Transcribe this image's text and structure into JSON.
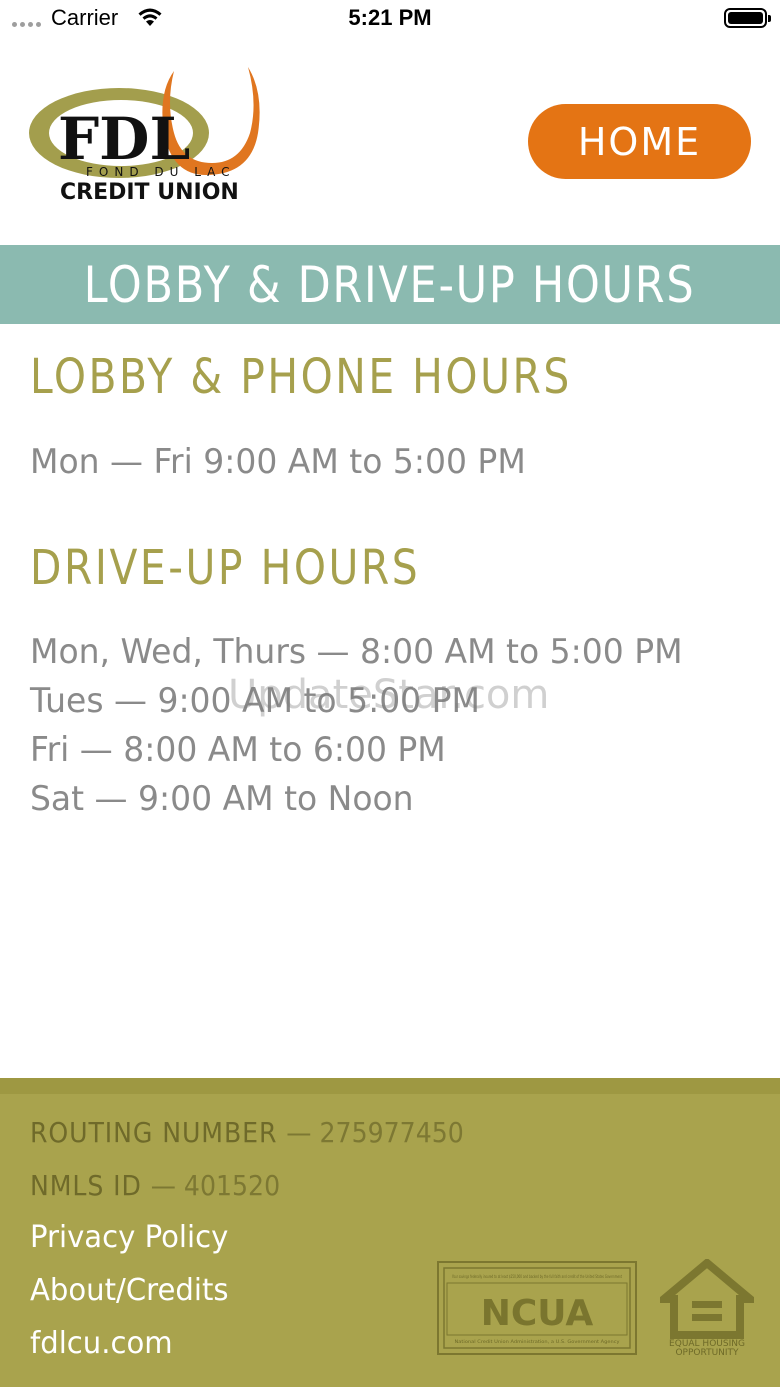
{
  "status_bar": {
    "carrier": "Carrier",
    "time": "5:21 PM"
  },
  "header": {
    "logo": {
      "brand": "FDL",
      "tagline": "FOND DU LAC",
      "subtitle": "CREDIT UNION",
      "colors": {
        "gold": "#a39e4d",
        "orange": "#e07620",
        "black": "#111111"
      }
    },
    "home_button": "HOME"
  },
  "title": "LOBBY & DRIVE-UP HOURS",
  "sections": {
    "lobby": {
      "heading": "LOBBY & PHONE HOURS",
      "lines": [
        "Mon — Fri 9:00 AM to 5:00 PM"
      ]
    },
    "drive_up": {
      "heading": "DRIVE-UP HOURS",
      "lines": [
        "Mon, Wed, Thurs — 8:00 AM to 5:00 PM",
        "Tues — 9:00 AM to 5:00 PM",
        "Fri — 8:00 AM to 6:00 PM",
        "Sat — 9:00 AM to Noon"
      ]
    }
  },
  "watermark": "UpdateStar.com",
  "footer": {
    "routing_label": "ROUTING NUMBER",
    "routing_value": "— 275977450",
    "nmls_label": "NMLS ID",
    "nmls_value": "— 401520",
    "links": [
      "Privacy Policy",
      "About/Credits",
      "fdlcu.com"
    ],
    "ncua_badge": {
      "name": "NCUA",
      "top_text": "Your savings federally insured to at least $250,000 and backed by the full faith and credit of the United States Government",
      "bottom_text": "National Credit Union Administration, a U.S. Government Agency"
    },
    "ehl_badge": {
      "line1": "EQUAL HOUSING",
      "line2": "OPPORTUNITY"
    }
  },
  "colors": {
    "accent_orange": "#e47414",
    "banner_teal": "#8bbab0",
    "heading_gold": "#a6a04d",
    "footer_olive": "#a9a34d",
    "body_gray": "#8a8a8a"
  }
}
